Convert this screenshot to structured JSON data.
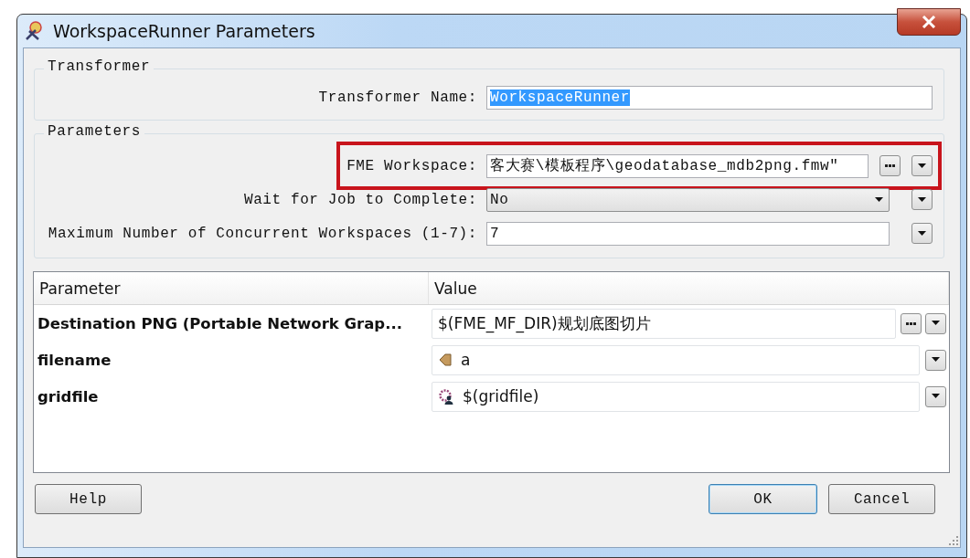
{
  "window": {
    "title": "WorkspaceRunner Parameters"
  },
  "transformer_group": {
    "title": "Transformer",
    "fields": [
      {
        "label": "Transformer Name:",
        "value": "WorkspaceRunner",
        "selected": true
      }
    ]
  },
  "parameters_group": {
    "title": "Parameters",
    "fields": [
      {
        "kind": "file",
        "label": "FME Workspace:",
        "value": "客大赛\\模板程序\\geodatabase_mdb2png.fmw″",
        "highlighted": true
      },
      {
        "kind": "dropdown",
        "label": "Wait for Job to Complete:",
        "value": "No",
        "highlighted": false
      },
      {
        "kind": "text",
        "label": "Maximum Number of Concurrent Workspaces (1-7):",
        "value": "7",
        "highlighted": false
      }
    ]
  },
  "table": {
    "columns": [
      "Parameter",
      "Value"
    ],
    "rows": [
      {
        "kind": "file",
        "name": "Destination PNG (Portable Network Grap...",
        "value": "$(FME_MF_DIR)规划底图切片"
      },
      {
        "kind": "attribute",
        "name": "filename",
        "value": "a"
      },
      {
        "kind": "published",
        "name": "gridfile",
        "value": "$(gridfile)"
      }
    ]
  },
  "buttons": [
    {
      "label": "Help",
      "default": false
    },
    {
      "label": "OK",
      "default": true
    },
    {
      "label": "Cancel",
      "default": false
    }
  ]
}
